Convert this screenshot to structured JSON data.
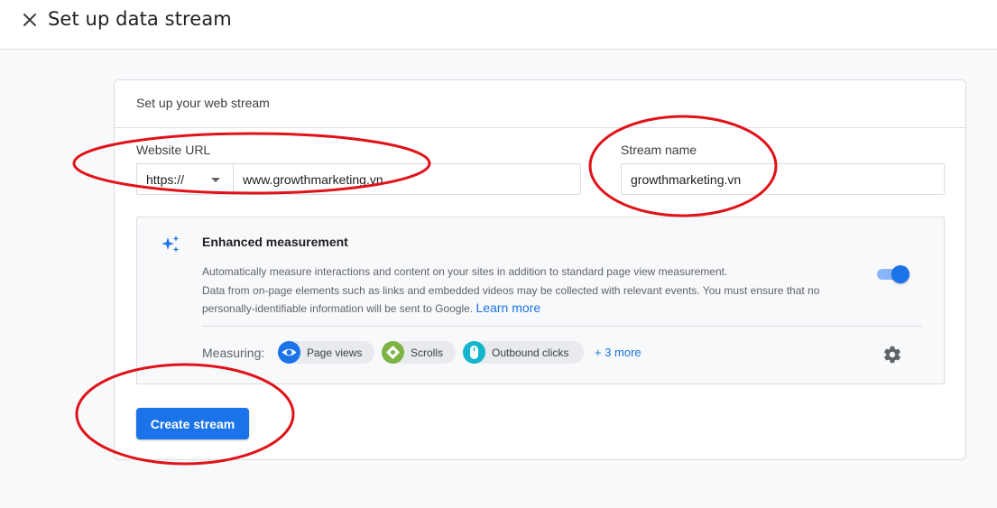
{
  "header": {
    "title": "Set up data stream",
    "close_icon": "close-icon"
  },
  "card": {
    "title": "Set up your web stream",
    "website_url": {
      "label": "Website URL",
      "protocol": "https://",
      "value": "www.growthmarketing.vn"
    },
    "stream_name": {
      "label": "Stream name",
      "value": "growthmarketing.vn"
    }
  },
  "enhanced": {
    "icon": "sparkle-icon",
    "title": "Enhanced measurement",
    "description_1": "Automatically measure interactions and content on your sites in addition to standard page view measurement.",
    "description_2": "Data from on-page elements such as links and embedded videos may be collected with relevant events. You must ensure that no personally-identifiable information will be sent to Google.",
    "learn_more": "Learn more",
    "toggle_on": true,
    "measuring_label": "Measuring:",
    "chips": [
      {
        "label": "Page views",
        "icon": "eye-icon",
        "color": "#1a73e8"
      },
      {
        "label": "Scrolls",
        "icon": "scroll-icon",
        "color": "#7cb342"
      },
      {
        "label": "Outbound clicks",
        "icon": "mouse-icon",
        "color": "#12b5cb"
      }
    ],
    "more": "+ 3 more",
    "settings_icon": "gear-icon"
  },
  "actions": {
    "create_label": "Create stream"
  },
  "colors": {
    "accent": "#1a73e8",
    "annotation": "#e0131a"
  }
}
